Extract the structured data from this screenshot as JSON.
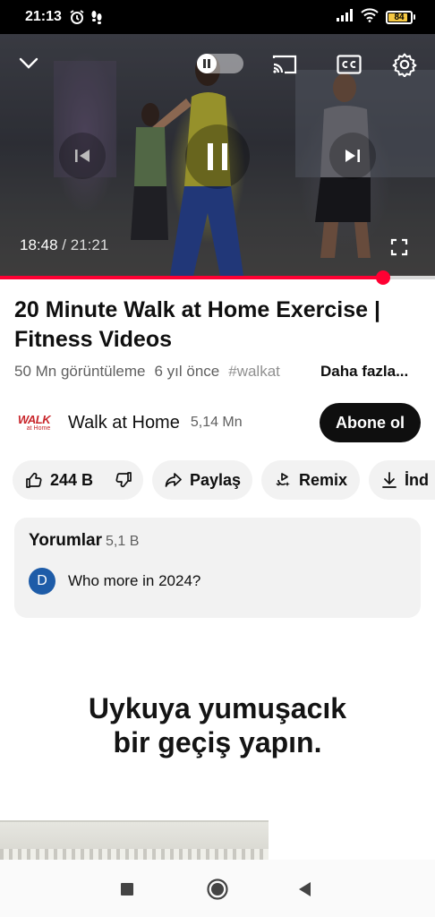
{
  "status_bar": {
    "time": "21:13",
    "battery": "84",
    "icons": [
      "alarm-icon",
      "footsteps-icon",
      "signal-icon",
      "wifi-icon",
      "battery-icon"
    ]
  },
  "player": {
    "current_time": "18:48",
    "separator": "/",
    "duration": "21:21",
    "progress_fraction": 0.88,
    "icons": [
      "chevron-down-icon",
      "autoplay-toggle-icon",
      "cast-icon",
      "captions-icon",
      "settings-icon",
      "previous-icon",
      "pause-icon",
      "next-icon",
      "fullscreen-icon"
    ]
  },
  "video": {
    "title": "20 Minute Walk at Home Exercise | Fitness Videos",
    "views": "50 Mn görüntüleme",
    "age": "6 yıl önce",
    "hashtag": "#walkat",
    "more": "Daha fazla..."
  },
  "channel": {
    "logo_line1": "WALK",
    "logo_line2": "at Home",
    "name": "Walk at Home",
    "subscribers": "5,14 Mn",
    "subscribe_label": "Abone ol"
  },
  "actions": {
    "likes": "244 B",
    "share": "Paylaş",
    "remix": "Remix",
    "download": "İnd"
  },
  "comments": {
    "header": "Yorumlar",
    "count": "5,1 B",
    "avatar_letter": "D",
    "top_comment": "Who more in 2024?"
  },
  "ad": {
    "headline_line1": "Uykuya yumuşacık",
    "headline_line2": "bir geçiş yapın."
  },
  "colors": {
    "accent": "#ff0033",
    "subscribe_bg": "#0f0f0f",
    "chip_bg": "#f2f2f2",
    "avatar_bg": "#1e5ca8",
    "brand_logo": "#c8262b"
  }
}
